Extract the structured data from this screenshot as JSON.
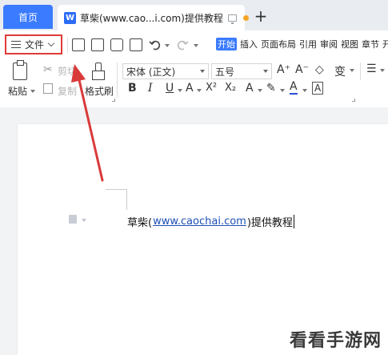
{
  "tabs": {
    "home_label": "首页",
    "doc_icon_letter": "W",
    "doc_title": "草柴(www.cao...i.com)提供教程",
    "add_symbol": "+"
  },
  "toolbar": {
    "file_label": "文件",
    "menu_tabs": [
      "开始",
      "插入",
      "页面布局",
      "引用",
      "审阅",
      "视图",
      "章节",
      "开"
    ],
    "paste_label": "粘贴",
    "cut_label": "剪切",
    "copy_label": "复制",
    "format_painter_label": "格式刷",
    "font_name": "宋体 (正文)",
    "font_size": "五号",
    "bold": "B",
    "italic": "I",
    "underline": "U",
    "font_color_a": "A",
    "superscript": "X²",
    "subscript": "X₂",
    "text_effect": "A",
    "highlight": "✎",
    "font_color": "A",
    "char_border": "A",
    "grow_font": "A⁺",
    "shrink_font": "A⁻",
    "clear_format": "◇",
    "phonetic": "变"
  },
  "document": {
    "text_before": "草柴(",
    "link_text": "www.caochai.com",
    "text_after": ")提供教程"
  },
  "watermark": "看看手游网",
  "colors": {
    "accent": "#3a7bff",
    "highlight_box": "#e03a3a",
    "arrow": "#d93a3a",
    "link": "#1f4fb5",
    "unsaved_dot": "#f5a623"
  }
}
